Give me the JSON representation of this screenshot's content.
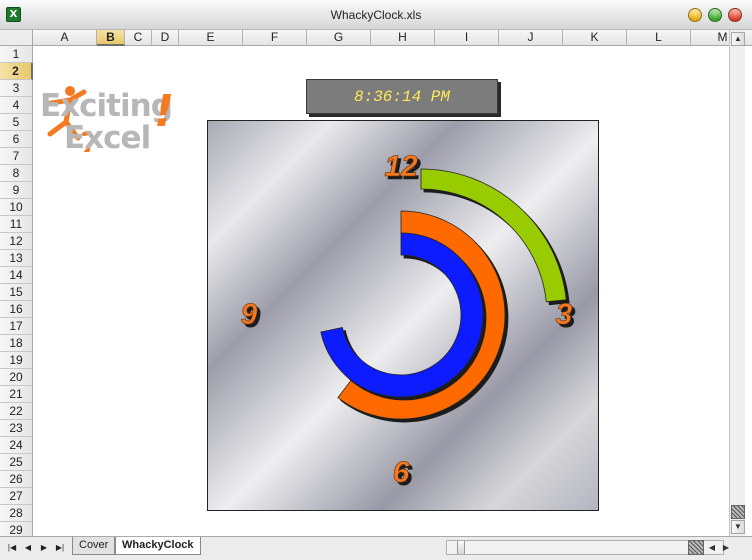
{
  "window": {
    "title": "WhackyClock.xls",
    "app_icon": "excel-icon"
  },
  "columns": [
    "A",
    "B",
    "C",
    "D",
    "E",
    "F",
    "G",
    "H",
    "I",
    "J",
    "K",
    "L",
    "M"
  ],
  "active_column": "B",
  "rows": [
    "1",
    "2",
    "3",
    "4",
    "5",
    "6",
    "7",
    "8",
    "9",
    "10",
    "11",
    "12",
    "13",
    "14",
    "15",
    "16",
    "17",
    "18",
    "19",
    "20",
    "21",
    "22",
    "23",
    "24",
    "25",
    "26",
    "27",
    "28",
    "29"
  ],
  "active_row": "2",
  "logo": {
    "word1": "Exciting",
    "word2": "Excel",
    "mark": "!"
  },
  "digital_clock": {
    "time": "8:36:14 PM"
  },
  "clock_face": {
    "numerals": {
      "twelve": "12",
      "three": "3",
      "six": "6",
      "nine": "9"
    },
    "time": {
      "hours": 8,
      "minutes": 36,
      "seconds": 14
    },
    "colors": {
      "hour_ring": "#0a1aff",
      "minute_ring": "#ff6a00",
      "second_ring": "#99cc00",
      "numeral": "#f47920"
    }
  },
  "sheets": [
    {
      "label": "Cover",
      "active": false
    },
    {
      "label": "WhackyClock",
      "active": true
    }
  ],
  "nav_icons": [
    "first-sheet-icon",
    "prev-sheet-icon",
    "next-sheet-icon",
    "last-sheet-icon"
  ]
}
